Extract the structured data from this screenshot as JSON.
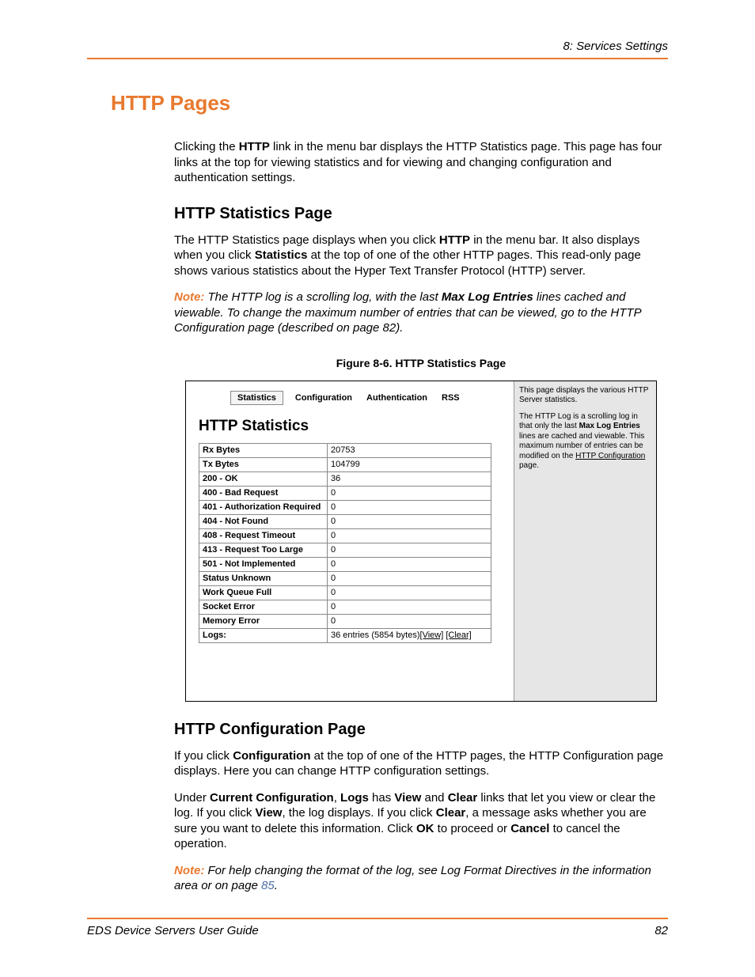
{
  "header": {
    "section": "8: Services Settings"
  },
  "h1": "HTTP Pages",
  "intro": {
    "p1_a": "Clicking the ",
    "p1_b": "HTTP",
    "p1_c": " link in the menu bar displays the HTTP Statistics page. This page has four links at the top for viewing statistics and for viewing and changing configuration and authentication settings."
  },
  "stats": {
    "heading": "HTTP Statistics Page",
    "p1_a": "The HTTP Statistics page displays when you click ",
    "p1_b": "HTTP",
    "p1_c": " in the menu bar. It also displays when you click ",
    "p1_d": "Statistics",
    "p1_e": " at the top of one of the other HTTP pages. This read-only page shows various statistics about the Hyper Text Transfer Protocol (HTTP) server.",
    "note_label": "Note:",
    "note_a": " The HTTP log is a scrolling log, with the last ",
    "note_b": "Max Log Entries",
    "note_c": " lines cached and viewable. To change the maximum number of entries that can be viewed, go to the HTTP Configuration page (described on page 82)."
  },
  "figure": {
    "caption": "Figure 8-6. HTTP Statistics Page",
    "tabs": {
      "statistics": "Statistics",
      "configuration": "Configuration",
      "authentication": "Authentication",
      "rss": "RSS"
    },
    "sshot_heading": "HTTP Statistics",
    "rows": [
      {
        "k": "Rx Bytes",
        "v": "20753"
      },
      {
        "k": "Tx Bytes",
        "v": "104799"
      },
      {
        "k": "200 - OK",
        "v": "36"
      },
      {
        "k": "400 - Bad Request",
        "v": "0"
      },
      {
        "k": "401 - Authorization Required",
        "v": "0"
      },
      {
        "k": "404 - Not Found",
        "v": "0"
      },
      {
        "k": "408 - Request Timeout",
        "v": "0"
      },
      {
        "k": "413 - Request Too Large",
        "v": "0"
      },
      {
        "k": "501 - Not Implemented",
        "v": "0"
      },
      {
        "k": "Status Unknown",
        "v": "0"
      },
      {
        "k": "Work Queue Full",
        "v": "0"
      },
      {
        "k": "Socket Error",
        "v": "0"
      },
      {
        "k": "Memory Error",
        "v": "0"
      }
    ],
    "logs_label": "Logs:",
    "logs_value_a": "36 entries (5854 bytes)",
    "logs_view": "[View]",
    "logs_clear": "[Clear]",
    "side": {
      "p1": "This page displays the various HTTP Server statistics.",
      "p2_a": "The HTTP Log is a scrolling log in that only the last ",
      "p2_b": "Max Log Entries",
      "p2_c": " lines are cached and viewable. This maximum number of entries can be modified on the ",
      "p2_link": "HTTP Configuration",
      "p2_d": " page."
    }
  },
  "config": {
    "heading": "HTTP Configuration Page",
    "p1_a": "If you click ",
    "p1_b": "Configuration",
    "p1_c": " at the top of one of the HTTP pages, the HTTP Configuration page displays. Here you can change HTTP configuration settings.",
    "p2_a": "Under ",
    "p2_b": "Current Configuration",
    "p2_c": ", ",
    "p2_d": "Logs",
    "p2_e": " has ",
    "p2_f": "View",
    "p2_g": " and ",
    "p2_h": "Clear",
    "p2_i": " links that let you view or clear the log. If you click ",
    "p2_j": "View",
    "p2_k": ", the log displays. If you click ",
    "p2_l": "Clear",
    "p2_m": ", a message asks whether you are sure you want to delete this information. Click ",
    "p2_n": "OK",
    "p2_o": " to proceed or ",
    "p2_p": "Cancel",
    "p2_q": " to cancel the operation.",
    "note_label": "Note:",
    "note_a": " For help changing the format of the log, see Log Format Directives in the information area or on page ",
    "note_ref": "85",
    "note_b": "."
  },
  "footer": {
    "title": "EDS Device Servers User Guide",
    "page": "82"
  }
}
